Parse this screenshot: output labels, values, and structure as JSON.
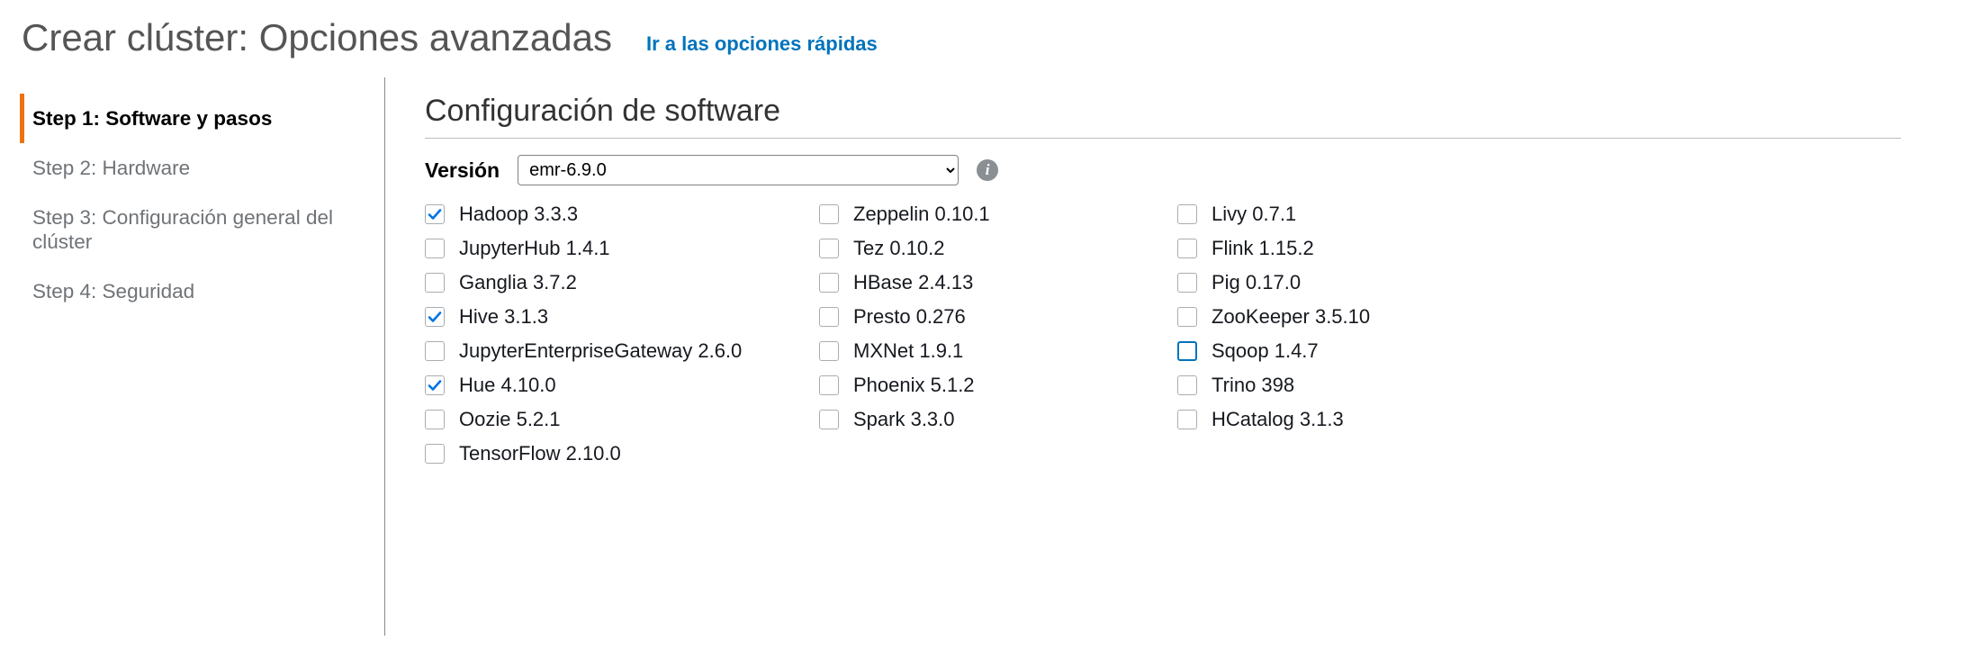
{
  "header": {
    "title": "Crear clúster: Opciones avanzadas",
    "quick_link": "Ir a las opciones rápidas"
  },
  "sidebar": {
    "steps": [
      {
        "label": "Step 1: Software y pasos",
        "active": true
      },
      {
        "label": "Step 2: Hardware",
        "active": false
      },
      {
        "label": "Step 3: Configuración general del clúster",
        "active": false
      },
      {
        "label": "Step 4: Seguridad",
        "active": false
      }
    ]
  },
  "main": {
    "section_title": "Configuración de software",
    "version_label": "Versión",
    "version_value": "emr-6.9.0",
    "apps_col1": [
      {
        "label": "Hadoop 3.3.3",
        "checked": true
      },
      {
        "label": "JupyterHub 1.4.1",
        "checked": false
      },
      {
        "label": "Ganglia 3.7.2",
        "checked": false
      },
      {
        "label": "Hive 3.1.3",
        "checked": true
      },
      {
        "label": "JupyterEnterpriseGateway 2.6.0",
        "checked": false
      },
      {
        "label": "Hue 4.10.0",
        "checked": true
      },
      {
        "label": "Oozie 5.2.1",
        "checked": false
      },
      {
        "label": "TensorFlow 2.10.0",
        "checked": false
      }
    ],
    "apps_col2": [
      {
        "label": "Zeppelin 0.10.1",
        "checked": false
      },
      {
        "label": "Tez 0.10.2",
        "checked": false
      },
      {
        "label": "HBase 2.4.13",
        "checked": false
      },
      {
        "label": "Presto 0.276",
        "checked": false
      },
      {
        "label": "MXNet 1.9.1",
        "checked": false
      },
      {
        "label": "Phoenix 5.1.2",
        "checked": false
      },
      {
        "label": "Spark 3.3.0",
        "checked": false
      }
    ],
    "apps_col3": [
      {
        "label": "Livy 0.7.1",
        "checked": false
      },
      {
        "label": "Flink 1.15.2",
        "checked": false
      },
      {
        "label": "Pig 0.17.0",
        "checked": false
      },
      {
        "label": "ZooKeeper 3.5.10",
        "checked": false
      },
      {
        "label": "Sqoop 1.4.7",
        "checked": false,
        "focused": true
      },
      {
        "label": "Trino 398",
        "checked": false
      },
      {
        "label": "HCatalog 3.1.3",
        "checked": false
      }
    ]
  }
}
